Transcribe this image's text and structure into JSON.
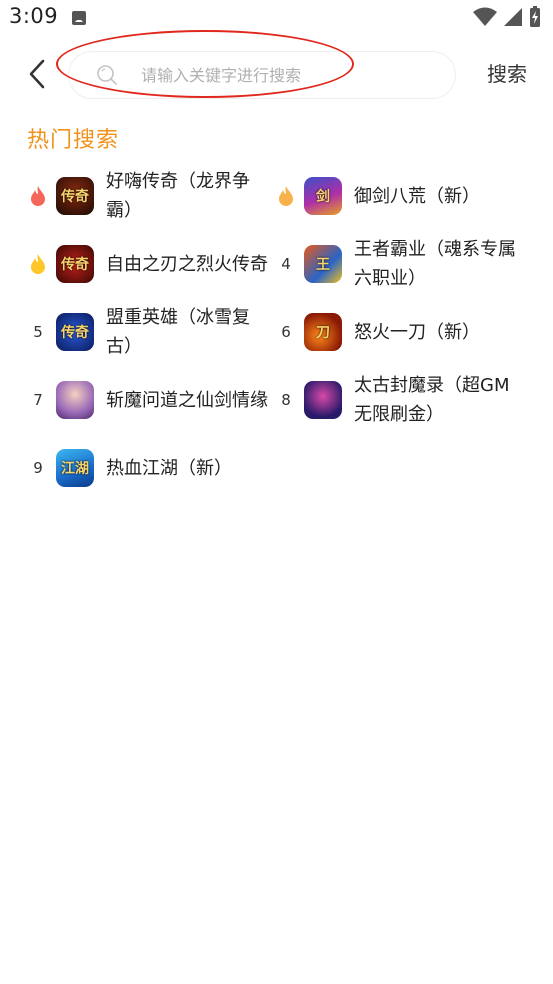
{
  "status": {
    "time": "3:09",
    "notification_icon": "app-notification-icon",
    "wifi_icon": "wifi-icon",
    "signal_icon": "signal-icon",
    "battery_icon": "battery-charging-icon"
  },
  "header": {
    "back_icon": "back-chevron-icon",
    "search_placeholder": "请输入关键字进行搜索",
    "search_value": "",
    "search_button": "搜索",
    "annotation_color": "#e0281c"
  },
  "hot": {
    "title": "热门搜索",
    "title_color": "#f0921b",
    "items": [
      {
        "rank": "1",
        "rank_icon": "flame-red-icon",
        "name": "好嗨传奇（龙界争霸）",
        "icon_label": "传奇"
      },
      {
        "rank": "2",
        "rank_icon": "flame-orange-icon",
        "name": "御剑八荒（新）",
        "icon_label": "剑"
      },
      {
        "rank": "3",
        "rank_icon": "flame-yellow-icon",
        "name": "自由之刃之烈火传奇",
        "icon_label": "传奇"
      },
      {
        "rank": "4",
        "rank_icon": "",
        "name": "王者霸业（魂系专属六职业）",
        "icon_label": "王"
      },
      {
        "rank": "5",
        "rank_icon": "",
        "name": "盟重英雄（冰雪复古）",
        "icon_label": "传奇"
      },
      {
        "rank": "6",
        "rank_icon": "",
        "name": "怒火一刀（新）",
        "icon_label": "刀"
      },
      {
        "rank": "7",
        "rank_icon": "",
        "name": "斩魔问道之仙剑情缘",
        "icon_label": ""
      },
      {
        "rank": "8",
        "rank_icon": "",
        "name": "太古封魔录（超GM无限刷金）",
        "icon_label": ""
      },
      {
        "rank": "9",
        "rank_icon": "",
        "name": "热血江湖（新）",
        "icon_label": "江湖"
      }
    ]
  }
}
